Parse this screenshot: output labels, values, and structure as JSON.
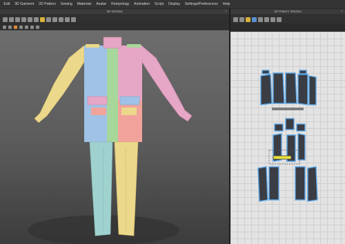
{
  "menu": {
    "items": [
      "Edit",
      "3D Garment",
      "2D Pattern",
      "Sewing",
      "Materials",
      "Avatar",
      "Retopology",
      "Animation",
      "Script",
      "Display",
      "Settings/Preferences",
      "Help"
    ]
  },
  "windows": {
    "view3d_title": "3D Window",
    "view2d_title": "2D Pattern Window"
  },
  "toolbar3d": {
    "icons": [
      "select-icon",
      "move-icon",
      "rotate-icon",
      "fold-icon",
      "pin-icon",
      "tape-icon",
      "brush-icon",
      "measure-icon",
      "avatar-icon",
      "settings-icon"
    ]
  },
  "colors": {
    "blue": "#9fc2e6",
    "green": "#a7d79a",
    "pink": "#e6a6c6",
    "yellow": "#ecd88a",
    "coral": "#f1a39b",
    "teal": "#9fd2cf",
    "pattern_fill": "#3a3d44",
    "pattern_outline": "#5aa6e8",
    "selection": "#e8e03a"
  }
}
